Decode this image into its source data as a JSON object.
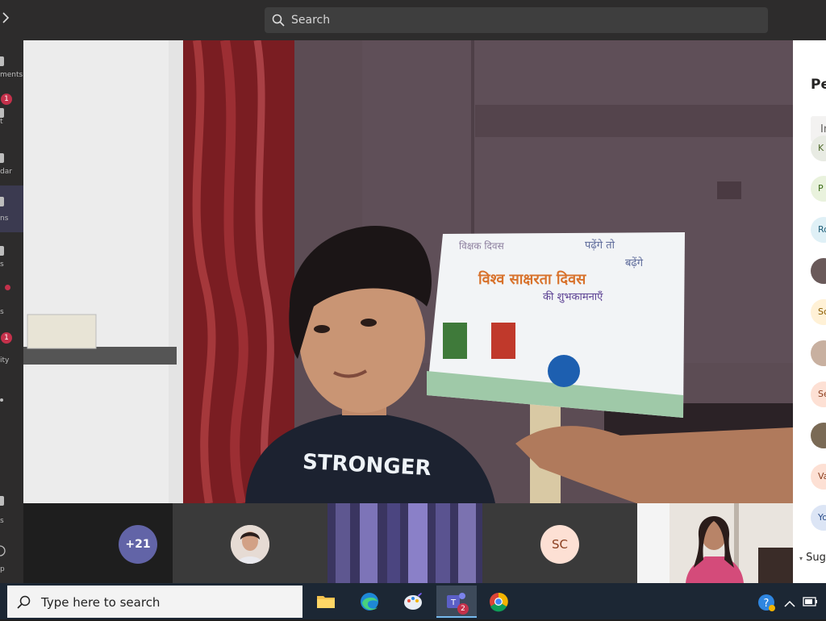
{
  "search": {
    "placeholder": "Search"
  },
  "rail": {
    "items": [
      {
        "label": "ments"
      },
      {
        "label": "t",
        "badge": "1"
      },
      {
        "label": "dar"
      },
      {
        "label": "ns"
      },
      {
        "label": "s"
      },
      {
        "label": "s"
      },
      {
        "label": "ity",
        "badge": "1"
      },
      {
        "label": "s"
      },
      {
        "label": "p"
      }
    ]
  },
  "video": {
    "sign_text_1": "विश्व साक्षरता दिवस",
    "sign_text_2": "की शुभकामनाएँ",
    "sign_text_top_left": "विक्षक दिवस",
    "sign_text_top_right": "पढ़ेंगे तो",
    "sign_text_top_right_2": "बढ़ेंगे",
    "shirt_text": "STRONGER"
  },
  "strip": {
    "more_count": "+21",
    "initials_tile": "SC"
  },
  "panel": {
    "title": "Pe",
    "input_placeholder": "In",
    "participants": [
      {
        "initials": "K",
        "color": "#e8ebe3",
        "text_color": "#4f6b2a"
      },
      {
        "initials": "P",
        "color": "#e9f2dd",
        "text_color": "#3a6b16"
      },
      {
        "initials": "Ro",
        "color": "#dff0f6",
        "text_color": "#1f5e78"
      },
      {
        "initials": "",
        "color": "#6a5a5a",
        "text_color": "#fff"
      },
      {
        "initials": "Sc",
        "color": "#fff1d6",
        "text_color": "#8a5b00"
      },
      {
        "initials": "",
        "color": "#c8b0a0",
        "text_color": "#fff"
      },
      {
        "initials": "Se",
        "color": "#fde0d4",
        "text_color": "#8a3f20"
      },
      {
        "initials": "",
        "color": "#7a6a55",
        "text_color": "#fff"
      },
      {
        "initials": "Va",
        "color": "#fde0d4",
        "text_color": "#8a3f20"
      },
      {
        "initials": "Yo",
        "color": "#dce5f5",
        "text_color": "#2d4e8a"
      }
    ],
    "suggested_label": "Sug"
  },
  "taskbar": {
    "search_placeholder": "Type here to search",
    "teams_badge": "2"
  }
}
